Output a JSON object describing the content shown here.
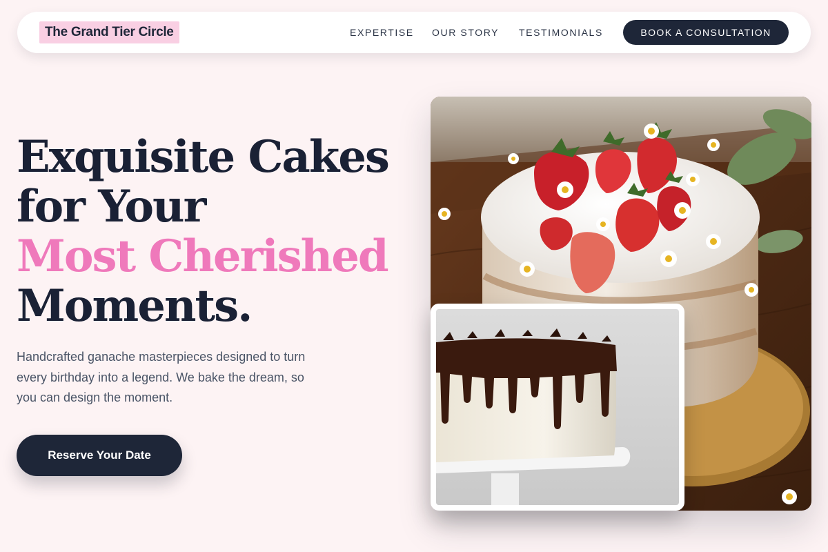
{
  "brand": {
    "name": "The Grand Tier Circle"
  },
  "nav": {
    "links": [
      {
        "label": "EXPERTISE"
      },
      {
        "label": "OUR STORY"
      },
      {
        "label": "TESTIMONIALS"
      }
    ],
    "cta_label": "BOOK A CONSULTATION"
  },
  "hero": {
    "headline": {
      "line1": "Exquisite Cakes",
      "line2": "for Your",
      "line3_accent": "Most Cherished",
      "line4": "Moments."
    },
    "lede": "Handcrafted ganache masterpieces designed to turn every birthday into a legend. We bake the dream, so you can design the moment.",
    "cta_label": "Reserve Your Date"
  },
  "images": {
    "main": "naked cake topped with strawberries and chamomile flowers",
    "inset": "white cake with chocolate ganache drip on a cake stand"
  },
  "colors": {
    "background": "#fdf3f4",
    "navy": "#1e2638",
    "accent_pink": "#ef79bb",
    "brand_highlight": "#f9cfe3"
  }
}
